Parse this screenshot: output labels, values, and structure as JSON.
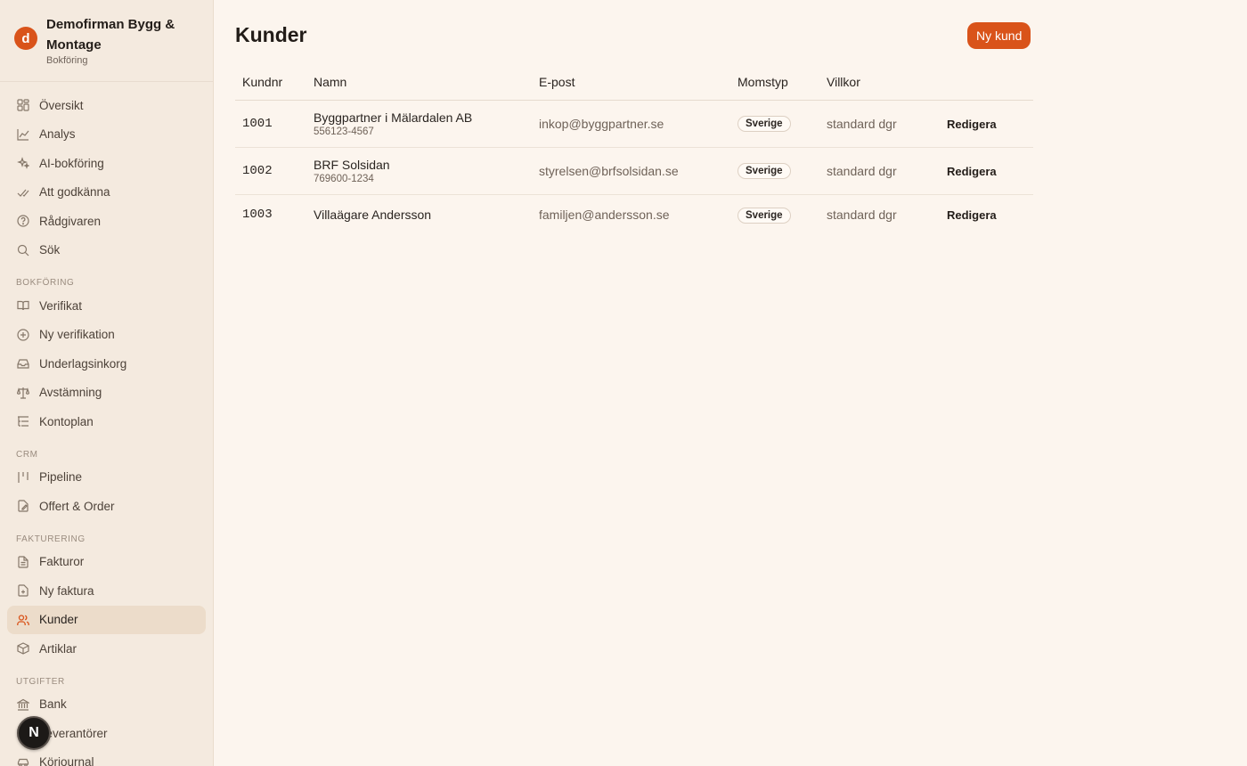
{
  "brand": {
    "logo_letter": "d",
    "name": "Demofirman Bygg & Montage",
    "sub": "Bokföring"
  },
  "nav": {
    "top": [
      {
        "label": "Översikt",
        "icon": "grid-icon"
      },
      {
        "label": "Analys",
        "icon": "chart-line-icon"
      },
      {
        "label": "AI-bokföring",
        "icon": "sparkles-icon"
      },
      {
        "label": "Att godkänna",
        "icon": "double-check-icon"
      },
      {
        "label": "Rådgivaren",
        "icon": "help-circle-icon"
      },
      {
        "label": "Sök",
        "icon": "search-icon"
      }
    ],
    "bokforing_label": "BOKFÖRING",
    "bokforing": [
      {
        "label": "Verifikat",
        "icon": "book-icon"
      },
      {
        "label": "Ny verifikation",
        "icon": "plus-circle-icon"
      },
      {
        "label": "Underlagsinkorg",
        "icon": "inbox-icon"
      },
      {
        "label": "Avstämning",
        "icon": "scale-icon"
      },
      {
        "label": "Kontoplan",
        "icon": "list-tree-icon"
      }
    ],
    "crm_label": "CRM",
    "crm": [
      {
        "label": "Pipeline",
        "icon": "kanban-icon"
      },
      {
        "label": "Offert & Order",
        "icon": "file-edit-icon"
      }
    ],
    "fakturering_label": "FAKTURERING",
    "fakturering": [
      {
        "label": "Fakturor",
        "icon": "file-text-icon"
      },
      {
        "label": "Ny faktura",
        "icon": "file-plus-icon"
      },
      {
        "label": "Kunder",
        "icon": "users-icon",
        "active": true
      },
      {
        "label": "Artiklar",
        "icon": "package-icon"
      }
    ],
    "utgifter_label": "UTGIFTER",
    "utgifter": [
      {
        "label": "Bank",
        "icon": "bank-icon"
      },
      {
        "label": "Leverantörer",
        "icon": "truck-icon"
      },
      {
        "label": "Körjournal",
        "icon": "car-icon"
      }
    ]
  },
  "fab": {
    "letter": "N"
  },
  "page": {
    "title": "Kunder",
    "new_button": "Ny kund"
  },
  "table": {
    "headers": [
      "Kundnr",
      "Namn",
      "E-post",
      "Momstyp",
      "Villkor",
      ""
    ],
    "rows": [
      {
        "nr": "1001",
        "name": "Byggpartner i Mälardalen AB",
        "org": "556123-4567",
        "email": "inkop@byggpartner.se",
        "vat": "Sverige",
        "terms": "standard dgr",
        "action": "Redigera"
      },
      {
        "nr": "1002",
        "name": "BRF Solsidan",
        "org": "769600-1234",
        "email": "styrelsen@brfsolsidan.se",
        "vat": "Sverige",
        "terms": "standard dgr",
        "action": "Redigera"
      },
      {
        "nr": "1003",
        "name": "Villaägare Andersson",
        "org": "",
        "email": "familjen@andersson.se",
        "vat": "Sverige",
        "terms": "standard dgr",
        "action": "Redigera"
      }
    ]
  }
}
